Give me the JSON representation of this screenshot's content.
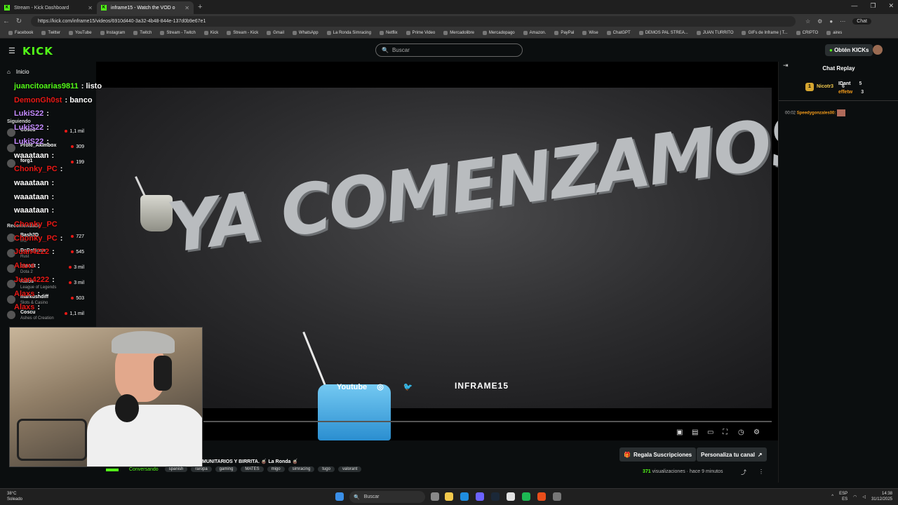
{
  "browser": {
    "tabs": [
      {
        "title": "Stream - Kick Dashboard"
      },
      {
        "title": "inframe15 - Watch the VOD o"
      }
    ],
    "url": "https://kick.com/inframe15/videos/6910d440-3a32-4b48-844e-137d0b9e67e1",
    "chat_button": "Chat",
    "bookmarks": [
      "Facebook",
      "Twitter",
      "YouTube",
      "Instagram",
      "Twitch",
      "Stream - Twitch",
      "Kick",
      "Stream - Kick",
      "Gmail",
      "WhatsApp",
      "La Ronda Simracing",
      "Netflix",
      "Prime Video",
      "Mercadolibre",
      "Mercadopago",
      "Amazon.",
      "PayPal",
      "Wise",
      "ChatGPT",
      "DEMOS PAL STREA...",
      "JUAN TURRITO",
      "GIFs de Inframe | T...",
      "CRIPTO",
      "aires"
    ]
  },
  "header": {
    "logo": "KICK",
    "search_placeholder": "Buscar",
    "kicks_button": "Obtén KICKs"
  },
  "sidebar": {
    "home": "Inicio",
    "following_title": "Siguiendo",
    "following": [
      {
        "name": "Coscu",
        "viewers": "1,1 mil"
      },
      {
        "name": "Profe_Akimbox",
        "viewers": "309"
      },
      {
        "name": "forg1",
        "viewers": "199"
      }
    ],
    "recommended_title": "Recomendado",
    "recommended": [
      {
        "name": "Bash3D",
        "game": "IRL",
        "viewers": "727"
      },
      {
        "name": "DeDeNnnn",
        "game": "Rust",
        "viewers": "545"
      },
      {
        "name": "brandt",
        "game": "Dota 2",
        "viewers": "3 mil"
      },
      {
        "name": "Kalos",
        "game": "League of Legends",
        "viewers": "3 mil"
      },
      {
        "name": "markushdiff",
        "game": "Slots & Casino",
        "viewers": "503"
      },
      {
        "name": "Coscu",
        "game": "Ashes of Creation",
        "viewers": "1,1 mil"
      }
    ]
  },
  "overlay_chat": [
    {
      "user": "juancitoarias9811",
      "msg": ": listo",
      "color": "#53fc18"
    },
    {
      "user": "DemonGh0st",
      "msg": ": banco",
      "color": "#e91916"
    },
    {
      "user": "LukiS22",
      "msg": ":",
      "color": "#c58bff"
    },
    {
      "user": "LukiS22",
      "msg": ":",
      "color": "#c58bff"
    },
    {
      "user": "LukiS22",
      "msg": ":",
      "color": "#c58bff"
    },
    {
      "user": "waaataan",
      "msg": ":",
      "color": "#ffffff"
    },
    {
      "user": "Chonky_PC",
      "msg": ":",
      "color": "#e91916"
    },
    {
      "user": "waaataan",
      "msg": ":",
      "color": "#ffffff"
    },
    {
      "user": "waaataan",
      "msg": ":",
      "color": "#ffffff"
    },
    {
      "user": "waaataan",
      "msg": ":",
      "color": "#ffffff"
    },
    {
      "user": "Chonky_PC",
      "msg": "",
      "color": "#e91916"
    },
    {
      "user": "Chonky_PC",
      "msg": ":",
      "color": "#e91916"
    },
    {
      "user": "Juan4222",
      "msg": ":",
      "color": "#e91916"
    },
    {
      "user": "Alaxs",
      "msg": ":",
      "color": "#e91916"
    },
    {
      "user": "Juan4222",
      "msg": ":",
      "color": "#e91916"
    },
    {
      "user": "Alaxs",
      "msg": ":",
      "color": "#e91916"
    },
    {
      "user": "Alaxs",
      "msg": ":",
      "color": "#e91916"
    }
  ],
  "video": {
    "headline": "YA COMENZAMOS",
    "social_youtube": "Youtube",
    "channel_tag": "INFRAME15"
  },
  "stream_info": {
    "title": "MUNITARIOS Y BIRRITA. 🧉 La Ronda 🧉",
    "category": "Conversando",
    "tags": [
      "spanish",
      "raropa",
      "gaming",
      "MATES",
      "migo",
      "simracing",
      "tugo",
      "valorant"
    ],
    "gift_button": "Regala Suscripciones",
    "customize_button": "Personaliza tu canal",
    "views_count": "371",
    "views_label": "visualizaciones",
    "time_ago": "hace 9 minutos"
  },
  "chat_replay": {
    "title": "Chat Replay",
    "leaders": [
      {
        "rank": "1",
        "name": "Nicotr3",
        "score": "6"
      },
      {
        "rank": "",
        "name": "IDant",
        "score": "5"
      },
      {
        "rank": "",
        "name": "effetw",
        "score": "3"
      }
    ],
    "messages": [
      {
        "time": "00:02",
        "user": "Speedygonzales00:"
      }
    ]
  },
  "taskbar": {
    "temp": "38°C",
    "weather": "Soleado",
    "search": "Buscar",
    "lang": "ESP",
    "lang2": "ES",
    "time": "14:38",
    "date": "31/12/2025"
  }
}
